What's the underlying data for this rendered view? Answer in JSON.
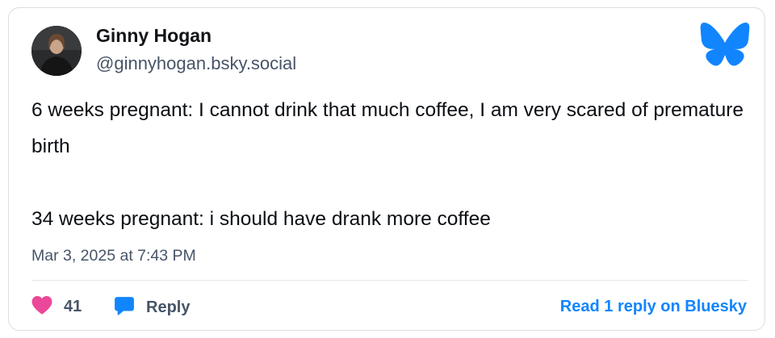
{
  "author": {
    "display_name": "Ginny Hogan",
    "handle": "@ginnyhogan.bsky.social",
    "avatar": "profile-photo"
  },
  "post": {
    "lines": [
      "6 weeks pregnant: I cannot drink that much coffee, I am very scared of premature birth",
      "34 weeks pregnant: i should have drank more coffee"
    ],
    "timestamp": "Mar 3, 2025 at 7:43 PM"
  },
  "actions": {
    "like_icon": "heart-icon",
    "like_count": "41",
    "reply_icon": "speech-bubble-icon",
    "reply_label": "Reply",
    "read_link": "Read 1 reply on Bluesky"
  },
  "brand": {
    "logo": "bluesky-butterfly-icon",
    "accent_color": "#1185fe",
    "like_color": "#ec4899"
  }
}
